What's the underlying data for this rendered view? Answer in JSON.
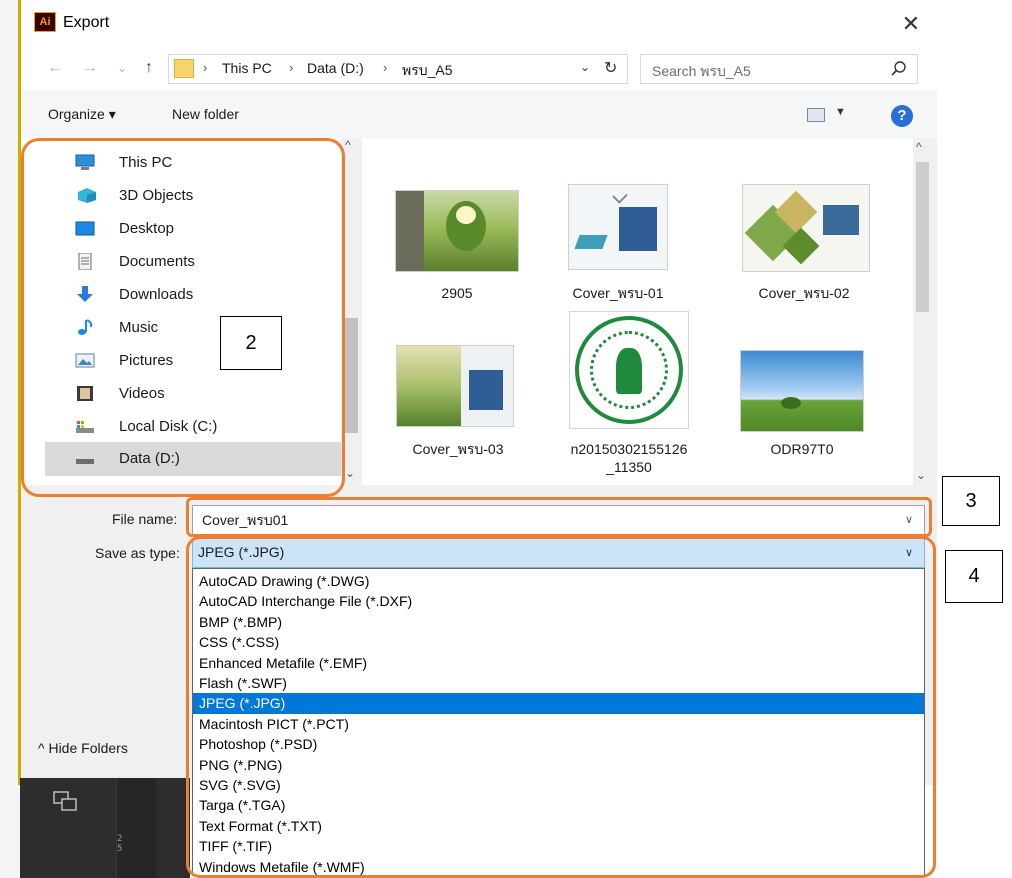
{
  "window": {
    "title": "Export",
    "app_icon": "Ai",
    "close": "✕"
  },
  "nav": {
    "back": "←",
    "forward": "→",
    "recent": "⌄",
    "up": "↑",
    "breadcrumbs": [
      "This PC",
      "Data (D:)",
      "พรบ_A5"
    ],
    "search_placeholder": "Search พรบ_A5"
  },
  "toolbar": {
    "organize": "Organize ▾",
    "new_folder": "New folder",
    "help": "?"
  },
  "nav_pane": {
    "items": [
      {
        "label": "This PC",
        "icon": "computer-icon"
      },
      {
        "label": "3D Objects",
        "icon": "3d-objects-icon"
      },
      {
        "label": "Desktop",
        "icon": "desktop-icon"
      },
      {
        "label": "Documents",
        "icon": "documents-icon"
      },
      {
        "label": "Downloads",
        "icon": "downloads-icon"
      },
      {
        "label": "Music",
        "icon": "music-icon"
      },
      {
        "label": "Pictures",
        "icon": "pictures-icon"
      },
      {
        "label": "Videos",
        "icon": "videos-icon"
      },
      {
        "label": "Local Disk (C:)",
        "icon": "local-disk-icon"
      },
      {
        "label": "Data (D:)",
        "icon": "drive-icon",
        "selected": true
      }
    ]
  },
  "files": [
    {
      "name": "2905"
    },
    {
      "name": "Cover_พรบ-01"
    },
    {
      "name": "Cover_พรบ-02"
    },
    {
      "name": "Cover_พรบ-03"
    },
    {
      "name": "n20150302155126\n_11350"
    },
    {
      "name": "ODR97T0"
    }
  ],
  "form": {
    "file_name_label": "File name:",
    "file_name_value": "Cover_พรบ01",
    "save_type_label": "Save as type:",
    "save_type_value": "JPEG (*.JPG)",
    "type_options": [
      "AutoCAD Drawing (*.DWG)",
      "AutoCAD Interchange File (*.DXF)",
      "BMP (*.BMP)",
      "CSS (*.CSS)",
      "Enhanced Metafile (*.EMF)",
      "Flash (*.SWF)",
      "JPEG (*.JPG)",
      "Macintosh PICT (*.PCT)",
      "Photoshop (*.PSD)",
      "PNG (*.PNG)",
      "SVG (*.SVG)",
      "Targa (*.TGA)",
      "Text Format (*.TXT)",
      "TIFF (*.TIF)",
      "Windows Metafile (*.WMF)"
    ],
    "selected_option": "JPEG (*.JPG)"
  },
  "hide_folders": "^  Hide Folders",
  "annotations": [
    "2",
    "3",
    "4"
  ],
  "ruler_marks": [
    "2",
    "5"
  ],
  "colors": {
    "accent": "#ed7d31",
    "selection": "#0078d7",
    "selection_soft": "#cce4f7"
  }
}
